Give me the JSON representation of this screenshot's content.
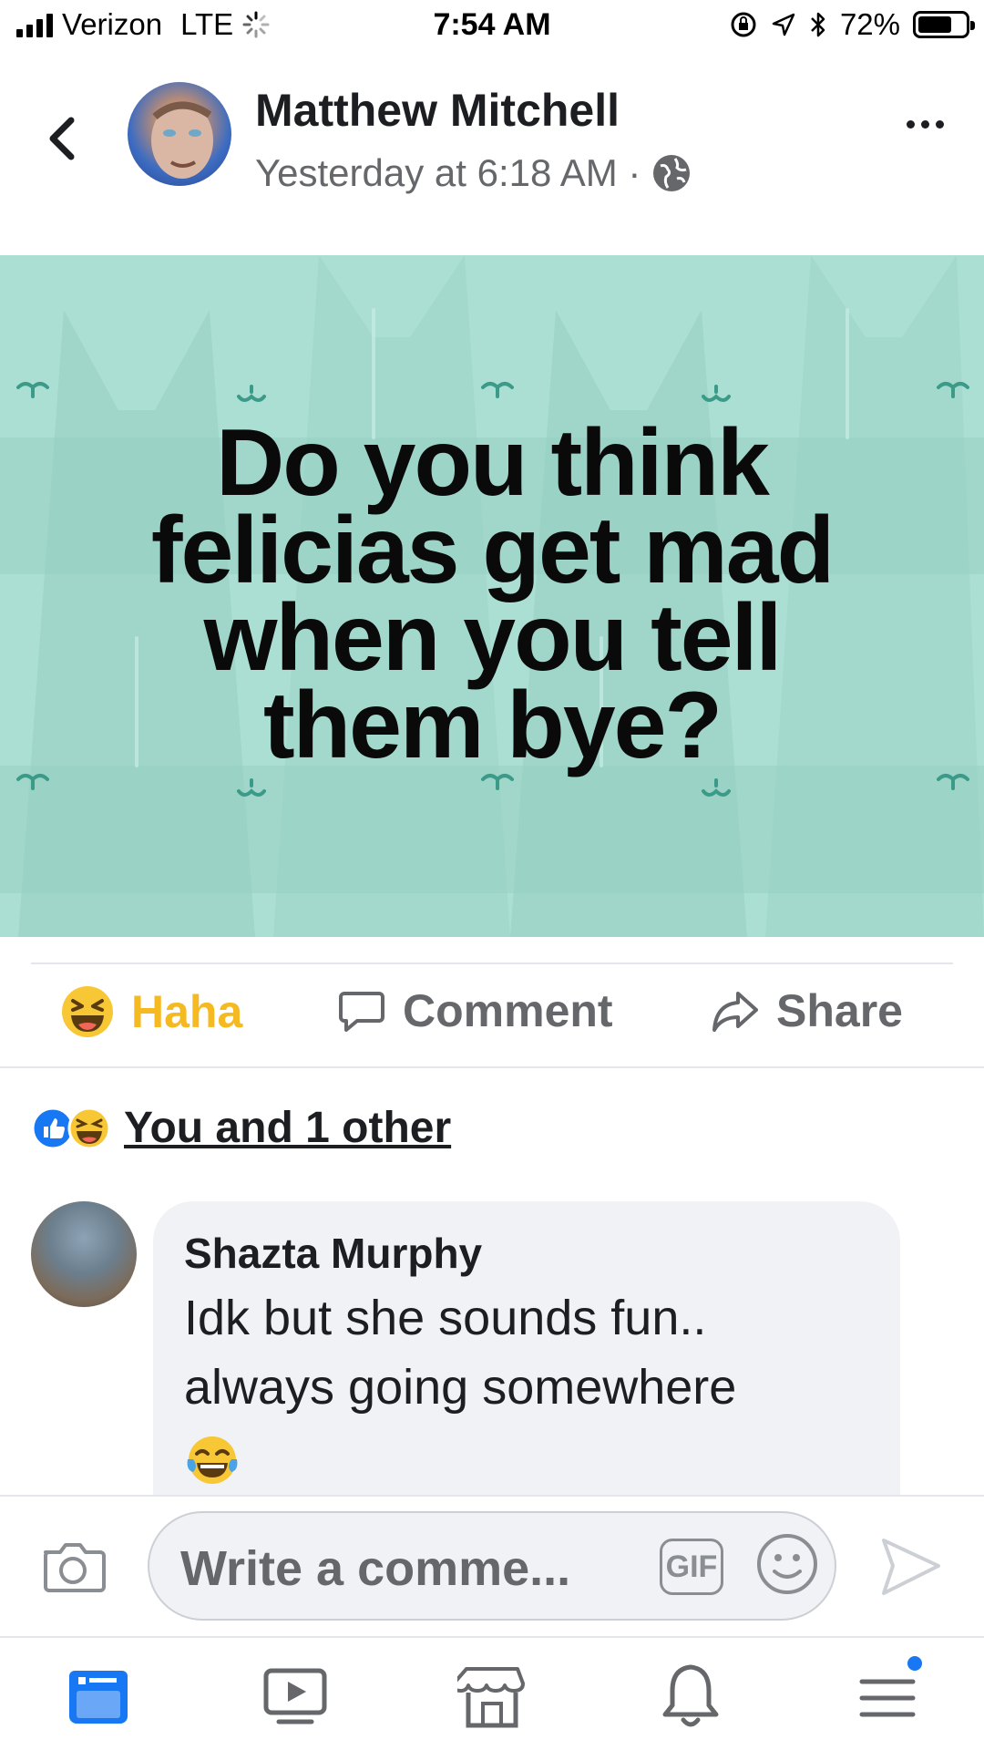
{
  "status_bar": {
    "carrier": "Verizon",
    "network": "LTE",
    "time": "7:54 AM",
    "battery": "72%",
    "battery_level": 0.72
  },
  "post": {
    "author": "Matthew Mitchell",
    "timestamp": "Yesterday at 6:18 AM ·",
    "privacy_icon": "globe-icon",
    "lines": [
      "Do you think",
      "felicias get mad",
      "when you tell",
      "them bye?"
    ],
    "background_color": "#acdfd3"
  },
  "actions": {
    "haha_label": "Haha",
    "comment_label": "Comment",
    "share_label": "Share",
    "haha_color": "#f5b922"
  },
  "reactions": {
    "summary": "You and 1 other"
  },
  "comment": {
    "name": "Shazta Murphy",
    "text": "Idk but she sounds fun.. always going somewhere",
    "emoji": "tears-of-joy-emoji"
  },
  "composer": {
    "placeholder": "Write a comme...",
    "gif_label": "GIF"
  },
  "nav": {
    "items": [
      "news-feed-icon",
      "watch-icon",
      "marketplace-icon",
      "notifications-icon",
      "menu-icon"
    ],
    "accent": "#1877f2"
  }
}
